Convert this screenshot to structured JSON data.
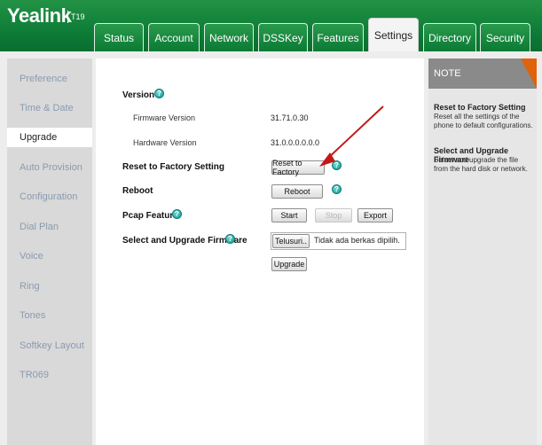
{
  "header": {
    "logo": "Yealink",
    "model": "T19"
  },
  "tabs": [
    {
      "label": "Status"
    },
    {
      "label": "Account"
    },
    {
      "label": "Network"
    },
    {
      "label": "DSSKey"
    },
    {
      "label": "Features"
    },
    {
      "label": "Settings",
      "active": true
    },
    {
      "label": "Directory"
    },
    {
      "label": "Security"
    }
  ],
  "sidebar": {
    "items": [
      {
        "label": "Preference"
      },
      {
        "label": "Time & Date"
      },
      {
        "label": "Upgrade",
        "active": true
      },
      {
        "label": "Auto Provision"
      },
      {
        "label": "Configuration"
      },
      {
        "label": "Dial Plan"
      },
      {
        "label": "Voice"
      },
      {
        "label": "Ring"
      },
      {
        "label": "Tones"
      },
      {
        "label": "Softkey Layout"
      },
      {
        "label": "TR069"
      }
    ]
  },
  "main": {
    "version_label": "Version",
    "firmware_version_label": "Firmware Version",
    "firmware_version_value": "31.71.0.30",
    "hardware_version_label": "Hardware Version",
    "hardware_version_value": "31.0.0.0.0.0.0",
    "reset_label": "Reset to Factory Setting",
    "reset_button": "Reset to Factory",
    "reboot_label": "Reboot",
    "reboot_button": "Reboot",
    "pcap_label": "Pcap Feature",
    "start_button": "Start",
    "stop_button": "Stop",
    "export_button": "Export",
    "upgrade_label": "Select and Upgrade Firmware",
    "browse_button": "Telusuri..",
    "file_status": "Tidak ada berkas dipilih.",
    "upgrade_button": "Upgrade",
    "help_glyph": "?"
  },
  "note": {
    "header": "NOTE",
    "reset_title": "Reset to Factory Setting",
    "reset_text": "Reset all the settings of the phone to default configurations.",
    "upgrade_title": "Select and Upgrade Firmware",
    "upgrade_text": "Select and upgrade the file from the hard disk or network."
  },
  "colors": {
    "header_green": "#0b7a35",
    "note_accent": "#e0620a",
    "annotation_arrow": "#c41818"
  }
}
